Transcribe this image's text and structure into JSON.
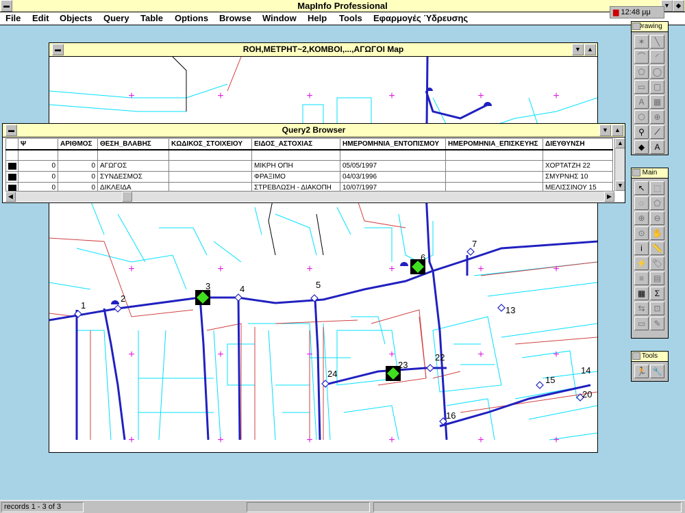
{
  "app": {
    "title": "MapInfo Professional"
  },
  "menu": [
    "File",
    "Edit",
    "Objects",
    "Query",
    "Table",
    "Options",
    "Browse",
    "Window",
    "Help",
    "Tools",
    "Εφαρμογές Ύδρευσης"
  ],
  "clock": "12:48 μμ",
  "map_window": {
    "title": "ROH,ΜΕΤΡΗΤ~2,ΚΟΜΒΟΙ,...,ΑΓΩΓΟΙ Map"
  },
  "map_labels": [
    "1",
    "2",
    "3",
    "4",
    "5",
    "6",
    "7",
    "13",
    "14",
    "15",
    "16",
    "20",
    "22",
    "23",
    "24"
  ],
  "browser": {
    "title": "Query2 Browser",
    "columns": [
      "Ψ",
      "ΑΡΙΘΜΟΣ",
      "ΘΕΣΗ_ΒΛΑΒΗΣ",
      "ΚΩΔΙΚΟΣ_ΣΤΟΙΧΕΙΟΥ",
      "ΕΙΔΟΣ_ΑΣΤΟΧΙΑΣ",
      "ΗΜΕΡΟΜΗΝΙΑ_ΕΝΤΟΠΙΣΜΟΥ",
      "ΗΜΕΡΟΜΗΝΙΑ_ΕΠΙΣΚΕΥΗΣ",
      "ΔΙΕΥΘΥΝΣΗ"
    ],
    "rows": [
      [
        "0",
        "0",
        "ΑΓΩΓΟΣ",
        "",
        "ΜΙΚΡΗ ΟΠΗ",
        "05/05/1997",
        "",
        "ΧΟΡΤΑΤΖΗ 22"
      ],
      [
        "0",
        "0",
        "ΣΥΝΔΕΣΜΟΣ",
        "",
        "ΦΡΑΞΙΜΟ",
        "04/03/1996",
        "",
        "ΣΜΥΡΝΗΣ 10"
      ],
      [
        "0",
        "0",
        "ΔΙΚΛΕΙΔΑ",
        "",
        "ΣΤΡΕΒΛΩΣΗ - ΔΙΑΚΟΠΗ",
        "10/07/1997",
        "",
        "ΜΕΛΙΣΣΙΝΟΥ 15"
      ]
    ]
  },
  "palettes": {
    "drawing": "Drawing",
    "main": "Main",
    "tools": "Tools"
  },
  "drawing_tools": [
    [
      "pointer-icon",
      "✶"
    ],
    [
      "line-icon",
      "╲"
    ],
    [
      "polyline-icon",
      "⌒"
    ],
    [
      "arc-icon",
      "◜"
    ],
    [
      "polygon-icon",
      "⬠"
    ],
    [
      "ellipse-icon",
      "◯"
    ],
    [
      "rectangle-icon",
      "▭"
    ],
    [
      "rounded-rect-icon",
      "▢"
    ],
    [
      "text-icon",
      "A"
    ],
    [
      "frame-icon",
      "▦"
    ],
    [
      "reshape-icon",
      "⬡"
    ],
    [
      "add-node-icon",
      "⊕"
    ],
    [
      "symbol-style-icon",
      "⚲"
    ],
    [
      "line-style-icon",
      "⟋"
    ],
    [
      "region-style-icon",
      "◆"
    ],
    [
      "text-style-icon",
      "A"
    ]
  ],
  "main_tools": [
    [
      "select-icon",
      "↖"
    ],
    [
      "marquee-select-icon",
      "⬚"
    ],
    [
      "radius-select-icon",
      "◌"
    ],
    [
      "polygon-select-icon",
      "⬠"
    ],
    [
      "zoom-in-icon",
      "⊕"
    ],
    [
      "zoom-out-icon",
      "⊖"
    ],
    [
      "change-view-icon",
      "⊙"
    ],
    [
      "grabber-icon",
      "✋"
    ],
    [
      "info-icon",
      "i"
    ],
    [
      "ruler-icon",
      "📏"
    ],
    [
      "hotlink-icon",
      "⚡"
    ],
    [
      "label-icon",
      "🏷"
    ],
    [
      "layer-control-icon",
      "≡"
    ],
    [
      "legend-icon",
      "▤"
    ],
    [
      "statistics-icon",
      "▦"
    ],
    [
      "sum-icon",
      "Σ"
    ],
    [
      "drag-map-icon",
      "⇆"
    ],
    [
      "clip-region-icon",
      "⊡"
    ],
    [
      "show-map-icon",
      "▭"
    ],
    [
      "cosmetic-icon",
      "✎"
    ]
  ],
  "tools_tools": [
    [
      "run-program-icon",
      "🏃"
    ],
    [
      "tool-manager-icon",
      "🔧"
    ]
  ],
  "status": {
    "records": "records 1 - 3 of 3"
  }
}
